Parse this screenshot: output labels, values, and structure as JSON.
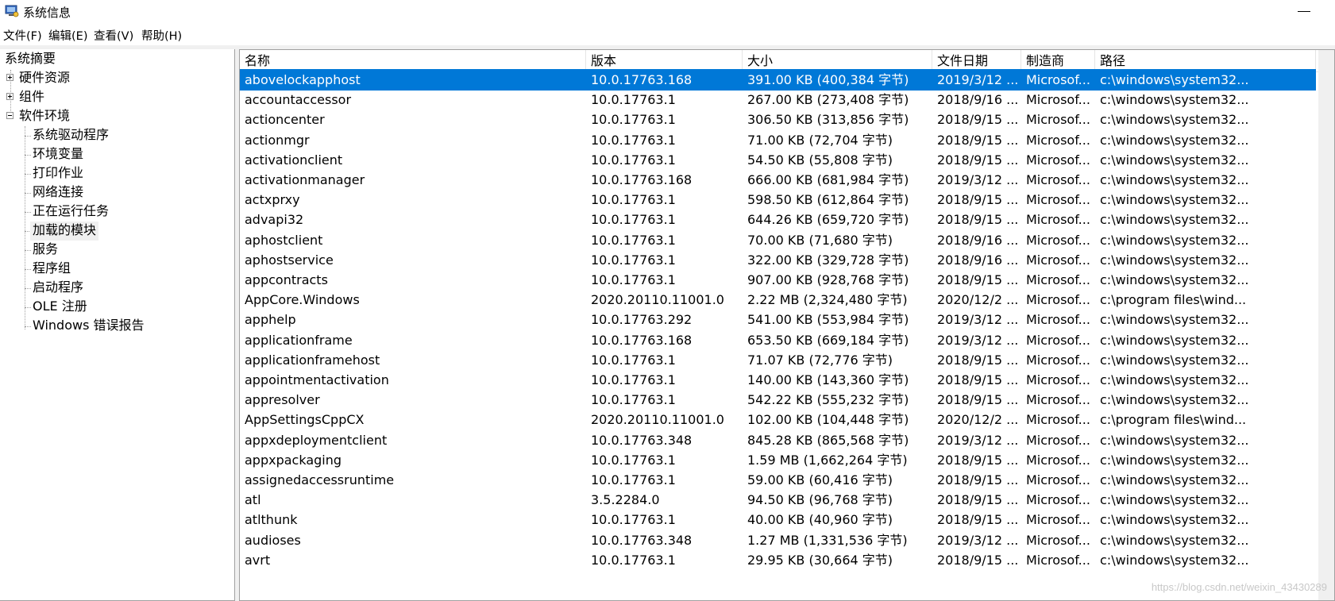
{
  "window": {
    "title": "系统信息",
    "minimize_glyph": "—"
  },
  "menu": [
    "文件(F)",
    "编辑(E)",
    "查看(V)",
    "帮助(H)"
  ],
  "tree": {
    "root": "系统摘要",
    "nodes": [
      {
        "label": "硬件资源",
        "expander": "plus"
      },
      {
        "label": "组件",
        "expander": "plus"
      },
      {
        "label": "软件环境",
        "expander": "minus"
      }
    ],
    "children": [
      "系统驱动程序",
      "环境变量",
      "打印作业",
      "网络连接",
      "正在运行任务",
      "加载的模块",
      "服务",
      "程序组",
      "启动程序",
      "OLE 注册",
      "Windows 错误报告"
    ],
    "selected_child": "加载的模块"
  },
  "table": {
    "columns": [
      "名称",
      "版本",
      "大小",
      "文件日期",
      "制造商",
      "路径"
    ],
    "rows": [
      [
        "abovelockapphost",
        "10.0.17763.168",
        "391.00 KB (400,384 字节)",
        "2019/3/12 ...",
        "Microsof...",
        "c:\\windows\\system32..."
      ],
      [
        "accountaccessor",
        "10.0.17763.1",
        "267.00 KB (273,408 字节)",
        "2018/9/16 ...",
        "Microsof...",
        "c:\\windows\\system32..."
      ],
      [
        "actioncenter",
        "10.0.17763.1",
        "306.50 KB (313,856 字节)",
        "2018/9/15 ...",
        "Microsof...",
        "c:\\windows\\system32..."
      ],
      [
        "actionmgr",
        "10.0.17763.1",
        "71.00 KB (72,704 字节)",
        "2018/9/15 ...",
        "Microsof...",
        "c:\\windows\\system32..."
      ],
      [
        "activationclient",
        "10.0.17763.1",
        "54.50 KB (55,808 字节)",
        "2018/9/15 ...",
        "Microsof...",
        "c:\\windows\\system32..."
      ],
      [
        "activationmanager",
        "10.0.17763.168",
        "666.00 KB (681,984 字节)",
        "2019/3/12 ...",
        "Microsof...",
        "c:\\windows\\system32..."
      ],
      [
        "actxprxy",
        "10.0.17763.1",
        "598.50 KB (612,864 字节)",
        "2018/9/15 ...",
        "Microsof...",
        "c:\\windows\\system32..."
      ],
      [
        "advapi32",
        "10.0.17763.1",
        "644.26 KB (659,720 字节)",
        "2018/9/15 ...",
        "Microsof...",
        "c:\\windows\\system32..."
      ],
      [
        "aphostclient",
        "10.0.17763.1",
        "70.00 KB (71,680 字节)",
        "2018/9/16 ...",
        "Microsof...",
        "c:\\windows\\system32..."
      ],
      [
        "aphostservice",
        "10.0.17763.1",
        "322.00 KB (329,728 字节)",
        "2018/9/16 ...",
        "Microsof...",
        "c:\\windows\\system32..."
      ],
      [
        "appcontracts",
        "10.0.17763.1",
        "907.00 KB (928,768 字节)",
        "2018/9/15 ...",
        "Microsof...",
        "c:\\windows\\system32..."
      ],
      [
        "AppCore.Windows",
        "2020.20110.11001.0",
        "2.22 MB (2,324,480 字节)",
        "2020/12/2 ...",
        "Microsof...",
        "c:\\program files\\wind..."
      ],
      [
        "apphelp",
        "10.0.17763.292",
        "541.00 KB (553,984 字节)",
        "2019/3/12 ...",
        "Microsof...",
        "c:\\windows\\system32..."
      ],
      [
        "applicationframe",
        "10.0.17763.168",
        "653.50 KB (669,184 字节)",
        "2019/3/12 ...",
        "Microsof...",
        "c:\\windows\\system32..."
      ],
      [
        "applicationframehost",
        "10.0.17763.1",
        "71.07 KB (72,776 字节)",
        "2018/9/15 ...",
        "Microsof...",
        "c:\\windows\\system32..."
      ],
      [
        "appointmentactivation",
        "10.0.17763.1",
        "140.00 KB (143,360 字节)",
        "2018/9/15 ...",
        "Microsof...",
        "c:\\windows\\system32..."
      ],
      [
        "appresolver",
        "10.0.17763.1",
        "542.22 KB (555,232 字节)",
        "2018/9/15 ...",
        "Microsof...",
        "c:\\windows\\system32..."
      ],
      [
        "AppSettingsCppCX",
        "2020.20110.11001.0",
        "102.00 KB (104,448 字节)",
        "2020/12/2 ...",
        "Microsof...",
        "c:\\program files\\wind..."
      ],
      [
        "appxdeploymentclient",
        "10.0.17763.348",
        "845.28 KB (865,568 字节)",
        "2019/3/12 ...",
        "Microsof...",
        "c:\\windows\\system32..."
      ],
      [
        "appxpackaging",
        "10.0.17763.1",
        "1.59 MB (1,662,264 字节)",
        "2018/9/15 ...",
        "Microsof...",
        "c:\\windows\\system32..."
      ],
      [
        "assignedaccessruntime",
        "10.0.17763.1",
        "59.00 KB (60,416 字节)",
        "2018/9/15 ...",
        "Microsof...",
        "c:\\windows\\system32..."
      ],
      [
        "atl",
        "3.5.2284.0",
        "94.50 KB (96,768 字节)",
        "2018/9/15 ...",
        "Microsof...",
        "c:\\windows\\system32..."
      ],
      [
        "atlthunk",
        "10.0.17763.1",
        "40.00 KB (40,960 字节)",
        "2018/9/15 ...",
        "Microsof...",
        "c:\\windows\\system32..."
      ],
      [
        "audioses",
        "10.0.17763.348",
        "1.27 MB (1,331,536 字节)",
        "2019/3/12 ...",
        "Microsof...",
        "c:\\windows\\system32..."
      ],
      [
        "avrt",
        "10.0.17763.1",
        "29.95 KB (30,664 字节)",
        "2018/9/15 ...",
        "Microsof...",
        "c:\\windows\\system32..."
      ]
    ],
    "selected_row": 0
  },
  "watermark": "https://blog.csdn.net/weixin_43430289",
  "colors": {
    "selection": "#0078d7",
    "pane_bg": "#ffffff",
    "chrome_bg": "#f0f0f0"
  }
}
